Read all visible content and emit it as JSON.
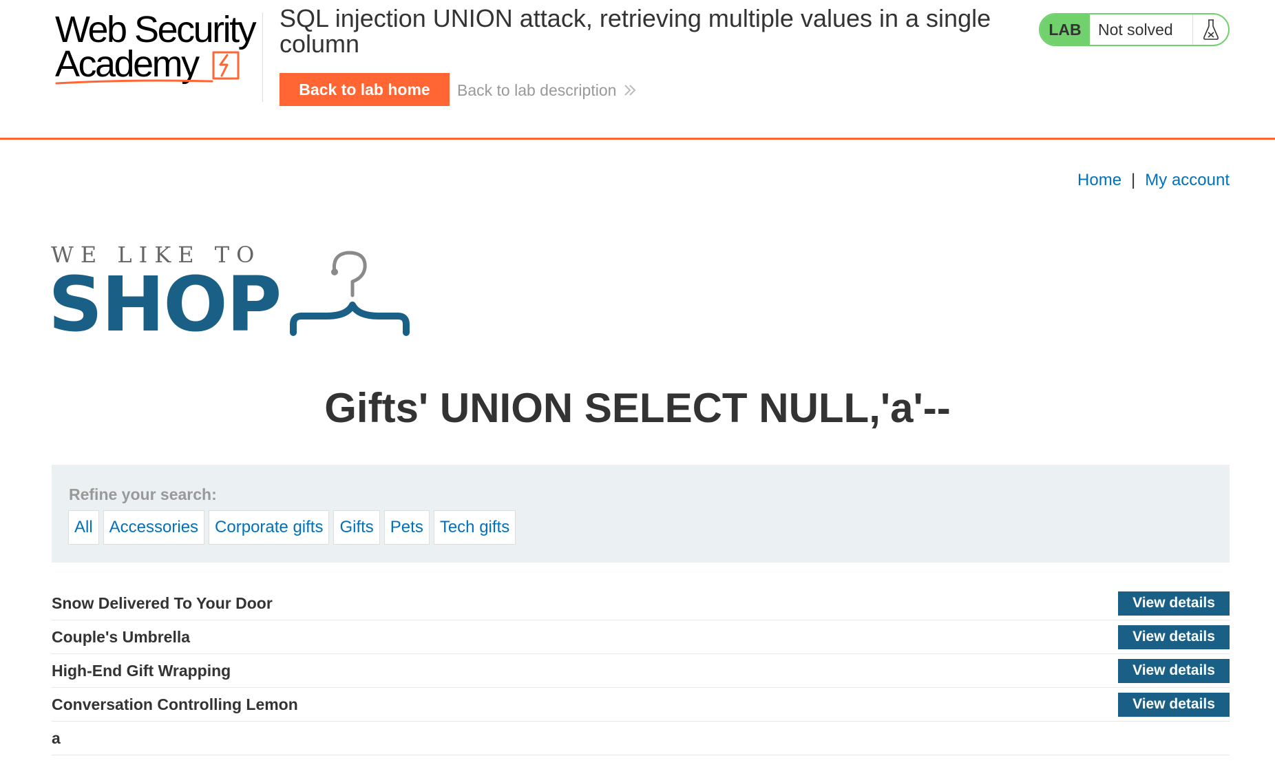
{
  "academy": {
    "logo_line1": "Web Security",
    "logo_line2": "Academy",
    "lab_title": "SQL injection UNION attack, retrieving multiple values in a single column",
    "back_home_label": "Back to lab home",
    "back_desc_label": "Back to lab description",
    "status_tag": "LAB",
    "status_text": "Not solved",
    "accent_color": "#ff6633",
    "status_color": "#70d16d",
    "icons": {
      "status": "flask-icon",
      "back_desc": "double-chevron-right-icon"
    }
  },
  "nav": {
    "home_label": "Home",
    "separator": "|",
    "account_label": "My account",
    "link_color": "#0071bc"
  },
  "shop_logo": {
    "tagline": "WE LIKE TO",
    "name": "SHOP",
    "icon": "hanger-icon",
    "brand_color": "#1a5f86"
  },
  "page": {
    "heading": "Gifts' UNION SELECT NULL,'a'--"
  },
  "filters": {
    "label": "Refine your search:",
    "items": [
      {
        "label": "All"
      },
      {
        "label": "Accessories"
      },
      {
        "label": "Corporate gifts"
      },
      {
        "label": "Gifts"
      },
      {
        "label": "Pets"
      },
      {
        "label": "Tech gifts"
      }
    ]
  },
  "products": {
    "button_label": "View details",
    "items": [
      {
        "name": "Snow Delivered To Your Door",
        "has_button": true
      },
      {
        "name": "Couple's Umbrella",
        "has_button": true
      },
      {
        "name": "High-End Gift Wrapping",
        "has_button": true
      },
      {
        "name": "Conversation Controlling Lemon",
        "has_button": true
      },
      {
        "name": "a",
        "has_button": false
      }
    ]
  }
}
